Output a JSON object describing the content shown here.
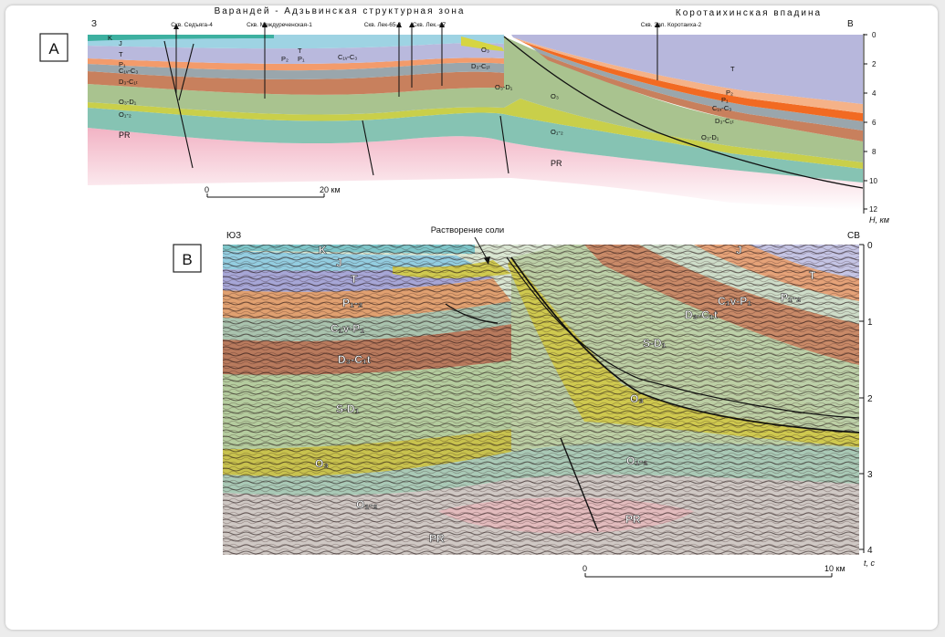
{
  "panelA": {
    "letter": "A",
    "left_edge": "З",
    "right_edge": "В",
    "zone_title": "Варандей - Адзьвинская структурная зона",
    "depression_title": "Коротаихинская впадина",
    "wells": [
      "Скв. Седъяга-4",
      "Скв. Междуреченская-1",
      "Скв. Лек-65-3",
      "Скв. Лек.-47",
      "Скв. Зап. Коротаиха-2"
    ],
    "depth_ticks": [
      "0",
      "2",
      "4",
      "6",
      "8",
      "10",
      "12"
    ],
    "depth_unit": "Н, км",
    "scale_start": "0",
    "scale_end": "20 км",
    "layers": {
      "K": "K",
      "J": "J",
      "T": "T",
      "P2": "P₂",
      "P1": "P₁",
      "C1P1": "C₁ᵥ-P₁",
      "C1V_C3": "C₁ᵥ-C₃",
      "D3C1": "D₃-C₁ₜ",
      "O3D1": "O₃-D₁",
      "O3": "O₃",
      "O12": "O₁-₂",
      "PR": "PR",
      "T_r": "T"
    }
  },
  "panelB": {
    "letter": "B",
    "left_edge": "ЮЗ",
    "right_edge": "СВ",
    "annotation": "Растворение соли",
    "time_ticks": [
      "0",
      "1",
      "2",
      "3",
      "4"
    ],
    "time_unit": "t, с",
    "scale_start": "0",
    "scale_end": "10 км",
    "layers": {
      "K": "K",
      "J": "J",
      "T": "T",
      "P": "P₁-₂",
      "CP": "C₁v-P₁",
      "DC": "D₃-C₁t",
      "SD": "S-D₁",
      "O3": "O₃",
      "O12": "O₁-₂",
      "PR": "PR",
      "Jr": "J",
      "Tr": "T",
      "Pr": "P₁-₂",
      "CPr": "C₁v-P₁",
      "DCr": "D₃-C₁t",
      "SDr": "S-D₁",
      "O3r": "O₃",
      "O12r": "O₁-₂",
      "PRr": "PR"
    }
  }
}
